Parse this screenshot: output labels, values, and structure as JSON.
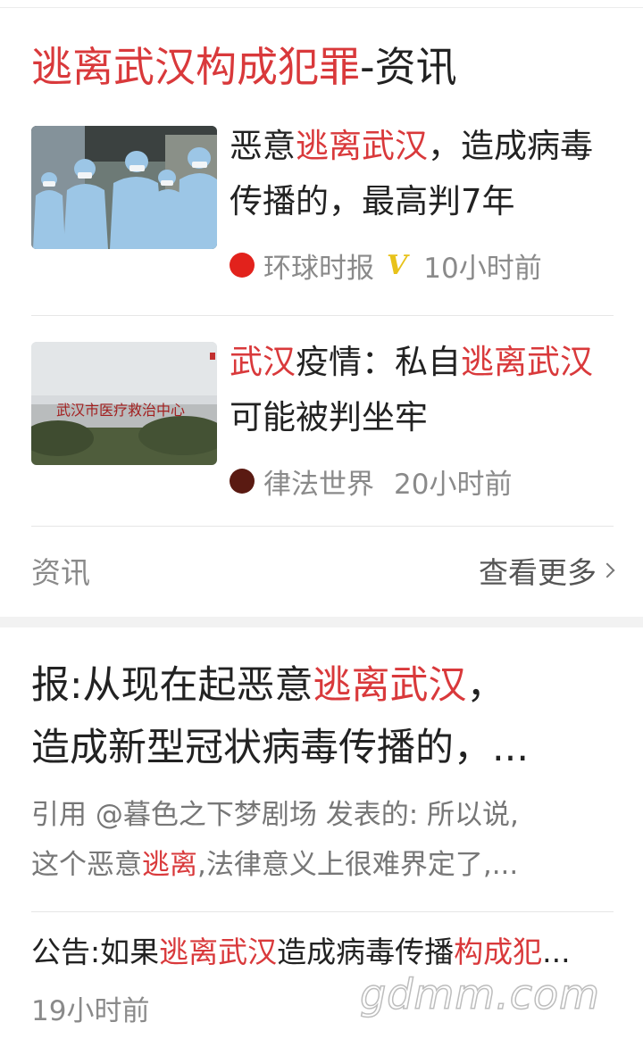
{
  "search_result_card": {
    "title_highlight": "逃离武汉构成犯罪",
    "title_suffix": "-资讯",
    "items": [
      {
        "title_parts": [
          "恶意",
          "逃离武汉",
          "，造成病毒传播的，最高判7年"
        ],
        "source": "环球时报",
        "verified_badge": "V",
        "time": "10小时前",
        "logo_color": "#e2221c",
        "thumbnail_desc": "medical staff in blue protective gowns"
      },
      {
        "title_parts": [
          "武汉",
          "疫情：私自",
          "逃离武汉",
          "可能被判坐牢"
        ],
        "source": "律法世界",
        "time": "20小时前",
        "logo_color": "#5a1a12",
        "thumbnail_desc": "武汉市医疗救治中心"
      }
    ],
    "footer_label": "资讯",
    "more_label": "查看更多"
  },
  "forum_post": {
    "title_line1_prefix": "报:从现在起恶意",
    "title_line1_highlight": "逃离武汉",
    "title_line1_suffix": "，",
    "title_line2": "造成新型冠状病毒传播的，...",
    "excerpt_line1": "引用 @暮色之下梦剧场 发表的: 所以说,",
    "excerpt_line2_prefix": "这个恶意",
    "excerpt_line2_highlight": "逃离",
    "excerpt_line2_suffix": ",法律意义上很难界定了,...",
    "notice_prefix": "公告:如果",
    "notice_highlight1": "逃离武汉",
    "notice_mid": "造成病毒传播",
    "notice_highlight2": "构成犯",
    "notice_suffix": "...",
    "notice_time": "19小时前"
  },
  "watermark": "gdmm.com",
  "colors": {
    "highlight": "#d9393b",
    "secondary_text": "#8a8a8a",
    "badge": "#e8c21a"
  }
}
